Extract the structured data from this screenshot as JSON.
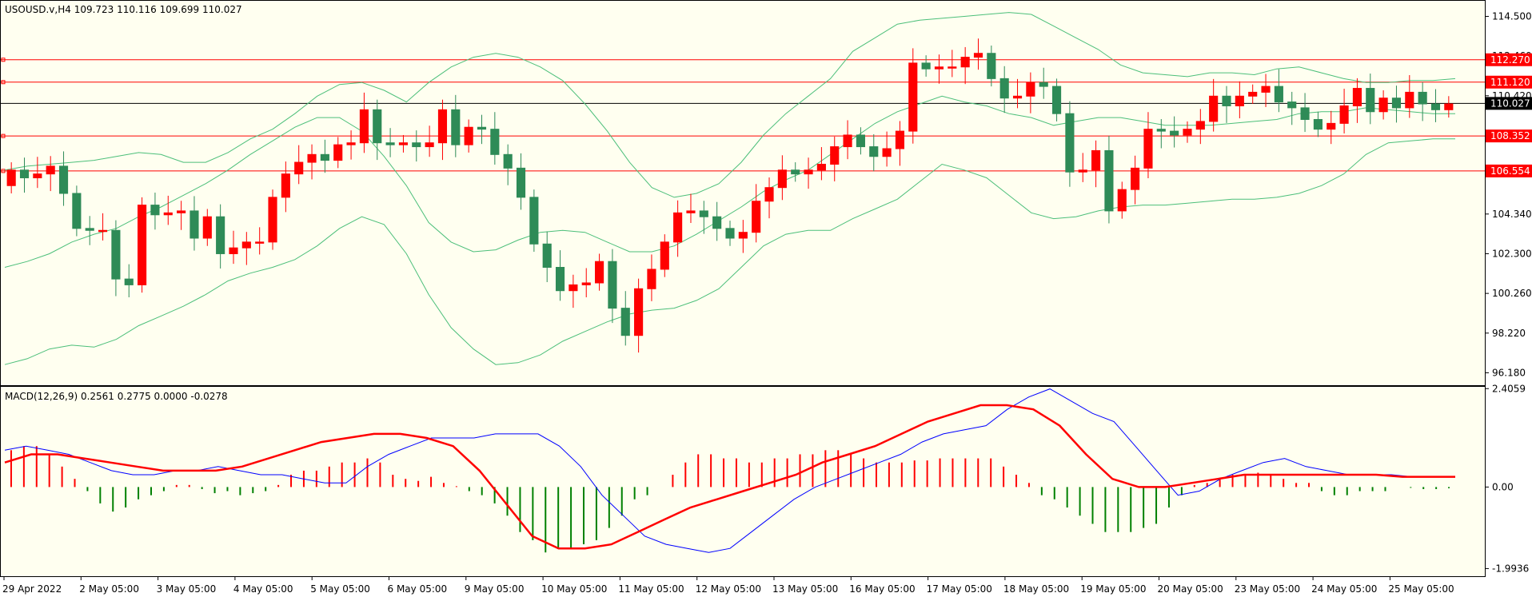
{
  "chart_data": [
    {
      "type": "candlestick",
      "title": "USOUSD.v,H4  109.723 110.116 109.699 110.027",
      "symbol": "USOUSD.v",
      "timeframe": "H4",
      "last_ohlc": {
        "open": 109.723,
        "high": 110.116,
        "low": 109.699,
        "close": 110.027
      },
      "ylim": [
        95.5,
        115.3
      ],
      "price_ticks": [
        "114.500",
        "112.460",
        "110.420",
        "108.380",
        "104.340",
        "102.300",
        "100.260",
        "98.220",
        "96.180"
      ],
      "horizontal_levels": [
        {
          "value": 112.27,
          "label": "112.270",
          "color": "#ff0000"
        },
        {
          "value": 111.12,
          "label": "111.120",
          "color": "#ff0000"
        },
        {
          "value": 108.352,
          "label": "108.352",
          "color": "#ff0000"
        },
        {
          "value": 106.554,
          "label": "106.554",
          "color": "#ff0000"
        }
      ],
      "current_price": {
        "value": 110.027,
        "label": "110.027"
      },
      "x_labels": [
        "29 Apr 2022",
        "2 May 05:00",
        "3 May 05:00",
        "4 May 05:00",
        "5 May 05:00",
        "6 May 05:00",
        "9 May 05:00",
        "10 May 05:00",
        "11 May 05:00",
        "12 May 05:00",
        "13 May 05:00",
        "16 May 05:00",
        "17 May 05:00",
        "18 May 05:00",
        "19 May 05:00",
        "20 May 05:00",
        "23 May 05:00",
        "24 May 05:00",
        "25 May 05:00"
      ],
      "close_series": [
        106.6,
        106.2,
        106.4,
        106.8,
        105.4,
        103.6,
        103.5,
        103.5,
        101.0,
        100.7,
        104.8,
        104.3,
        104.4,
        104.5,
        103.1,
        104.2,
        102.3,
        102.6,
        102.9,
        102.9,
        105.2,
        106.4,
        107.0,
        107.4,
        107.1,
        107.9,
        108.0,
        109.7,
        108.0,
        107.9,
        108.0,
        107.8,
        108.0,
        109.7,
        107.9,
        108.8,
        108.7,
        107.4,
        106.7,
        105.2,
        102.8,
        101.6,
        100.4,
        100.7,
        100.8,
        101.9,
        99.5,
        98.1,
        100.5,
        101.5,
        102.9,
        104.4,
        104.5,
        104.2,
        103.6,
        103.1,
        103.4,
        105.0,
        105.7,
        106.6,
        106.4,
        106.6,
        106.9,
        107.8,
        108.4,
        107.8,
        107.3,
        107.7,
        108.6,
        112.1,
        111.8,
        111.9,
        111.9,
        112.4,
        112.6,
        111.3,
        110.3,
        110.4,
        111.1,
        110.9,
        109.5,
        106.5,
        106.6,
        107.6,
        104.5,
        105.6,
        106.7,
        108.7,
        108.6,
        108.4,
        108.7,
        109.1,
        110.4,
        109.9,
        110.4,
        110.6,
        110.9,
        110.1,
        109.8,
        109.2,
        108.7,
        109.0,
        109.9,
        110.8,
        109.6,
        110.3,
        109.8,
        110.6,
        110.0,
        109.7,
        110.0
      ],
      "bands_upper": [
        106.6,
        106.8,
        106.9,
        107.0,
        107.1,
        107.3,
        107.5,
        107.4,
        107.0,
        107.0,
        107.5,
        108.2,
        108.7,
        109.5,
        110.4,
        111.0,
        111.1,
        110.7,
        110.1,
        111.1,
        111.9,
        112.4,
        112.6,
        112.4,
        111.9,
        111.2,
        110.0,
        108.6,
        107.0,
        105.7,
        105.2,
        105.4,
        105.9,
        107.0,
        108.4,
        109.5,
        110.4,
        111.3,
        112.7,
        113.4,
        114.1,
        114.3,
        114.4,
        114.5,
        114.6,
        114.7,
        114.6,
        114.0,
        113.4,
        112.8,
        112.0,
        111.6,
        111.5,
        111.4,
        111.6,
        111.6,
        111.5,
        111.8,
        111.9,
        111.6,
        111.3,
        111.1,
        111.1,
        111.2,
        111.2,
        111.3
      ],
      "bands_middle": [
        101.6,
        101.9,
        102.3,
        102.9,
        103.3,
        103.6,
        104.2,
        104.7,
        105.3,
        105.9,
        106.6,
        107.4,
        108.1,
        108.8,
        109.3,
        109.3,
        108.6,
        107.3,
        105.8,
        103.9,
        102.9,
        102.4,
        102.5,
        103.0,
        103.4,
        103.5,
        103.4,
        102.9,
        102.4,
        102.4,
        102.7,
        103.3,
        104.0,
        104.7,
        105.5,
        106.1,
        106.6,
        107.4,
        108.2,
        109.0,
        109.6,
        110.0,
        110.4,
        110.1,
        109.9,
        109.5,
        109.3,
        108.9,
        109.1,
        109.3,
        109.3,
        109.1,
        108.9,
        108.9,
        108.9,
        109.0,
        109.1,
        109.2,
        109.5,
        109.6,
        109.6,
        109.8,
        109.7,
        109.6,
        109.5,
        109.5
      ],
      "bands_lower": [
        96.6,
        96.9,
        97.4,
        97.6,
        97.5,
        97.9,
        98.6,
        99.1,
        99.6,
        100.2,
        100.9,
        101.3,
        101.6,
        102.0,
        102.7,
        103.6,
        104.2,
        103.8,
        102.3,
        100.2,
        98.5,
        97.4,
        96.6,
        96.7,
        97.1,
        97.8,
        98.3,
        98.8,
        99.2,
        99.4,
        99.5,
        99.9,
        100.5,
        101.6,
        102.7,
        103.3,
        103.5,
        103.5,
        104.1,
        104.6,
        105.1,
        106.0,
        106.9,
        106.6,
        106.2,
        105.3,
        104.4,
        104.1,
        104.2,
        104.5,
        104.7,
        104.8,
        104.8,
        104.9,
        105.0,
        105.1,
        105.1,
        105.2,
        105.4,
        105.8,
        106.4,
        107.4,
        108.0,
        108.1,
        108.2,
        108.2
      ]
    },
    {
      "type": "bar",
      "title": "MACD(12,26,9) 0.2561 0.2775 0.0000 -0.0278",
      "ylim": [
        -2.2,
        2.45
      ],
      "y_ticks": [
        "2.4059",
        "0.00",
        "-1.9936"
      ],
      "histogram": [
        0.9,
        1.0,
        1.0,
        0.8,
        0.5,
        0.2,
        -0.1,
        -0.4,
        -0.6,
        -0.5,
        -0.3,
        -0.2,
        -0.1,
        0.05,
        0.05,
        -0.05,
        -0.15,
        -0.1,
        -0.2,
        -0.15,
        -0.1,
        0.05,
        0.3,
        0.4,
        0.4,
        0.5,
        0.6,
        0.6,
        0.7,
        0.6,
        0.3,
        0.2,
        0.15,
        0.25,
        0.1,
        0.02,
        -0.1,
        -0.2,
        -0.4,
        -0.7,
        -1.1,
        -1.3,
        -1.6,
        -1.5,
        -1.5,
        -1.4,
        -1.3,
        -1.0,
        -0.7,
        -0.3,
        -0.2,
        0.0,
        0.3,
        0.6,
        0.8,
        0.8,
        0.7,
        0.7,
        0.6,
        0.6,
        0.7,
        0.7,
        0.8,
        0.8,
        0.9,
        0.9,
        0.8,
        0.7,
        0.6,
        0.6,
        0.6,
        0.65,
        0.65,
        0.7,
        0.7,
        0.7,
        0.7,
        0.7,
        0.5,
        0.3,
        0.1,
        -0.2,
        -0.3,
        -0.5,
        -0.7,
        -0.9,
        -1.1,
        -1.1,
        -1.1,
        -1.0,
        -0.9,
        -0.5,
        -0.2,
        0.05,
        0.1,
        0.2,
        0.3,
        0.3,
        0.35,
        0.3,
        0.2,
        0.1,
        0.1,
        -0.1,
        -0.2,
        -0.2,
        -0.1,
        -0.1,
        -0.1,
        0.0,
        -0.02,
        -0.05,
        -0.05,
        -0.03
      ],
      "macd_line": [
        0.9,
        1.0,
        0.9,
        0.8,
        0.6,
        0.4,
        0.3,
        0.3,
        0.4,
        0.4,
        0.5,
        0.4,
        0.3,
        0.3,
        0.2,
        0.1,
        0.1,
        0.5,
        0.8,
        1.0,
        1.2,
        1.2,
        1.2,
        1.3,
        1.3,
        1.3,
        1.0,
        0.5,
        -0.2,
        -0.7,
        -1.2,
        -1.4,
        -1.5,
        -1.6,
        -1.5,
        -1.1,
        -0.7,
        -0.3,
        0.0,
        0.2,
        0.4,
        0.6,
        0.8,
        1.1,
        1.3,
        1.4,
        1.5,
        1.9,
        2.2,
        2.4,
        2.1,
        1.8,
        1.6,
        1.0,
        0.4,
        -0.2,
        -0.1,
        0.2,
        0.4,
        0.6,
        0.7,
        0.5,
        0.4,
        0.3,
        0.3,
        0.3,
        0.25,
        0.25,
        0.25
      ],
      "signal_line": [
        0.6,
        0.8,
        0.8,
        0.7,
        0.6,
        0.5,
        0.4,
        0.4,
        0.4,
        0.5,
        0.7,
        0.9,
        1.1,
        1.2,
        1.3,
        1.3,
        1.2,
        1.0,
        0.4,
        -0.4,
        -1.2,
        -1.5,
        -1.5,
        -1.4,
        -1.1,
        -0.8,
        -0.5,
        -0.3,
        -0.1,
        0.1,
        0.3,
        0.6,
        0.8,
        1.0,
        1.3,
        1.6,
        1.8,
        2.0,
        2.0,
        1.9,
        1.5,
        0.8,
        0.2,
        0.0,
        0.0,
        0.1,
        0.2,
        0.3,
        0.3,
        0.3,
        0.3,
        0.3,
        0.3,
        0.25,
        0.25,
        0.25
      ],
      "colors": {
        "macd": "#0000ff",
        "signal": "#ff0000",
        "hist_pos": "#ff0000",
        "hist_neg": "#008000"
      }
    }
  ]
}
